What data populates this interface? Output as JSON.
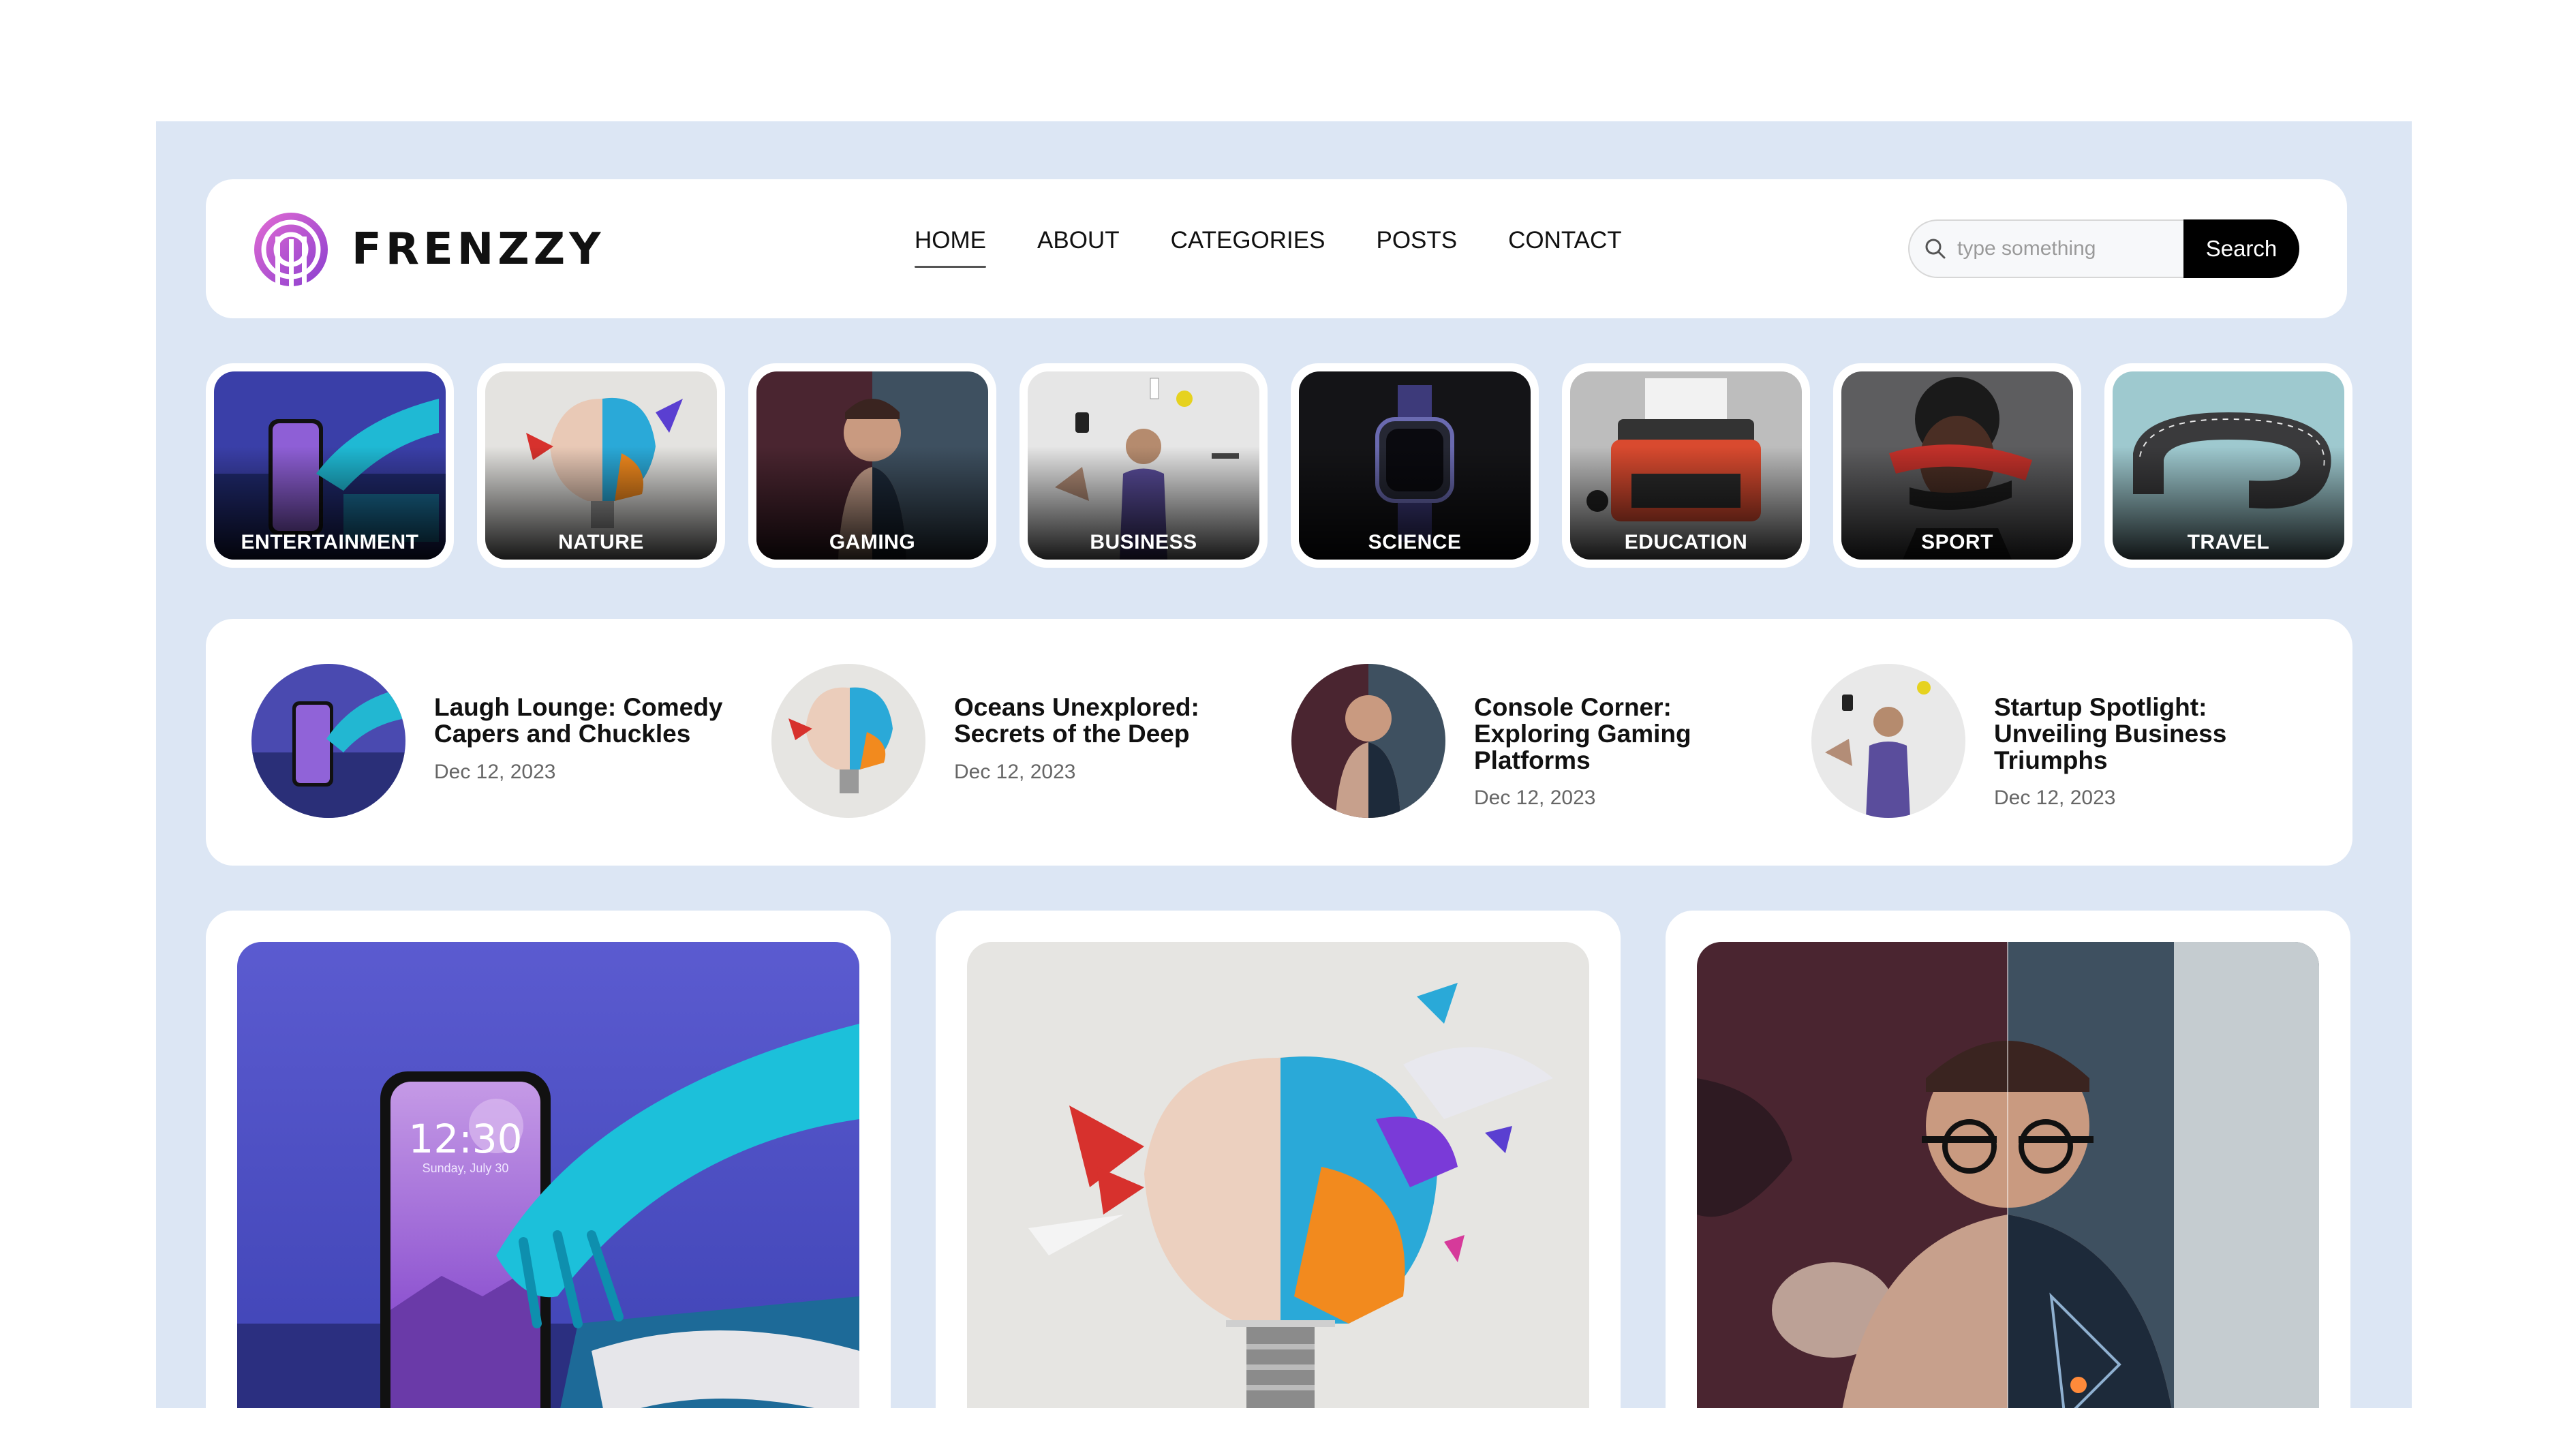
{
  "brand": {
    "name": "FRENZZY",
    "accent": "#b04fd8"
  },
  "nav": {
    "items": [
      "HOME",
      "ABOUT",
      "CATEGORIES",
      "POSTS",
      "CONTACT"
    ],
    "active": "HOME"
  },
  "search": {
    "placeholder": "type something",
    "button_label": "Search",
    "icon": "search-icon"
  },
  "categories": [
    {
      "label": "ENTERTAINMENT",
      "theme": "phone-hand"
    },
    {
      "label": "NATURE",
      "theme": "brain-bulb"
    },
    {
      "label": "GAMING",
      "theme": "split-man"
    },
    {
      "label": "BUSINESS",
      "theme": "floating-objects"
    },
    {
      "label": "SCIENCE",
      "theme": "smartwatch"
    },
    {
      "label": "EDUCATION",
      "theme": "typewriter"
    },
    {
      "label": "SPORT",
      "theme": "ribbon-face"
    },
    {
      "label": "TRAVEL",
      "theme": "curved-road"
    }
  ],
  "recent_posts": [
    {
      "title_lines": [
        "Laugh Lounge: Comedy",
        "Capers and Chuckles"
      ],
      "date": "Dec 12, 2023"
    },
    {
      "title_lines": [
        "Oceans Unexplored:",
        "Secrets of the Deep"
      ],
      "date": "Dec 12, 2023"
    },
    {
      "title_lines": [
        "Console Corner:",
        "Exploring Gaming",
        "Platforms"
      ],
      "date": "Dec 12, 2023"
    },
    {
      "title_lines": [
        "Startup Spotlight:",
        "Unveiling Business",
        "Triumphs"
      ],
      "date": "Dec 12, 2023"
    }
  ],
  "featured": {
    "phone_time": "12:30",
    "phone_date": "Sunday, July 30"
  }
}
